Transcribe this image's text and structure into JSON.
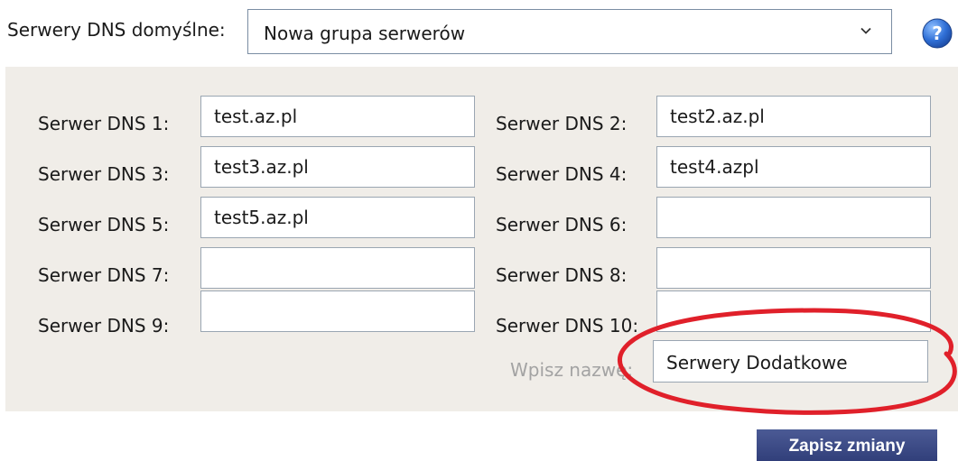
{
  "header": {
    "label": "Serwery DNS domyślne:",
    "select_value": "Nowa grupa serwerów",
    "help_icon": "question-mark-icon"
  },
  "dns_servers": [
    {
      "label": "Serwer DNS 1:",
      "value": "test.az.pl"
    },
    {
      "label": "Serwer DNS 2:",
      "value": "test2.az.pl"
    },
    {
      "label": "Serwer DNS 3:",
      "value": "test3.az.pl"
    },
    {
      "label": "Serwer DNS 4:",
      "value": "test4.azpl"
    },
    {
      "label": "Serwer DNS 5:",
      "value": "test5.az.pl"
    },
    {
      "label": "Serwer DNS 6:",
      "value": ""
    },
    {
      "label": "Serwer DNS 7:",
      "value": ""
    },
    {
      "label": "Serwer DNS 8:",
      "value": ""
    },
    {
      "label": "Serwer DNS 9:",
      "value": ""
    },
    {
      "label": "Serwer DNS 10:",
      "value": ""
    }
  ],
  "group_name": {
    "label": "Wpisz nazwę:",
    "value": "Serwery Dodatkowe"
  },
  "actions": {
    "save_label": "Zapisz zmiany"
  },
  "colors": {
    "panel_bg": "#f0ede8",
    "button_bg": "#3c4a86",
    "annotation": "#e0202a",
    "help_icon": "#2f6fd6"
  }
}
